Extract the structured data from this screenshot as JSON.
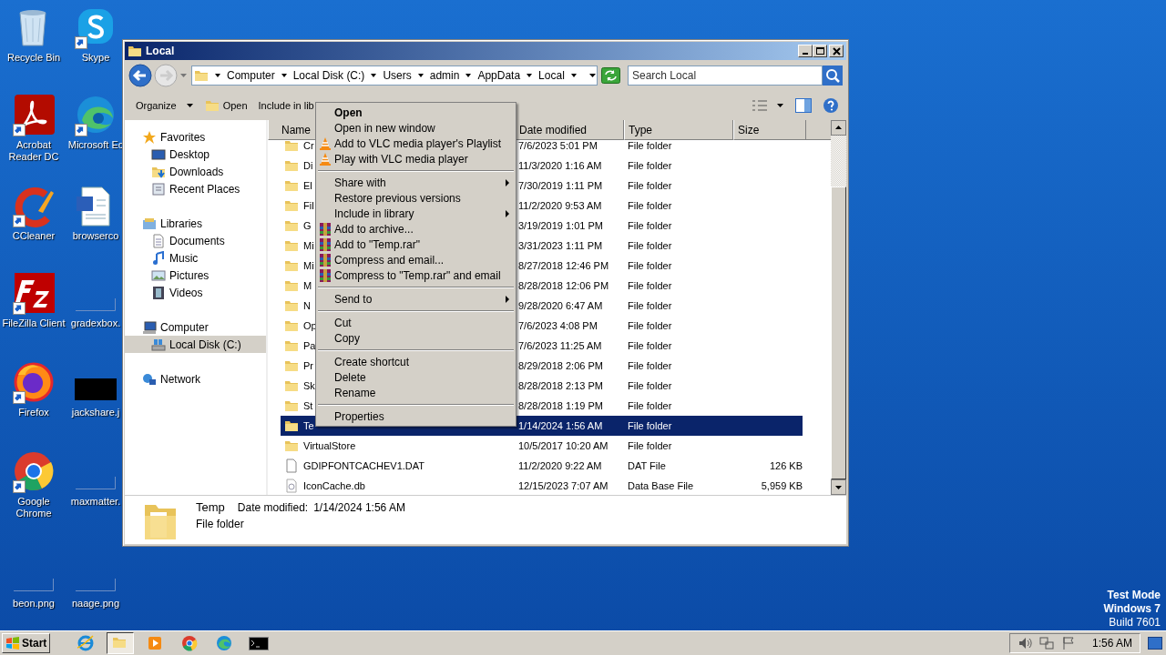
{
  "desktop": {
    "icons": [
      {
        "label": "Recycle Bin",
        "kind": "recycle",
        "shortcut": false
      },
      {
        "label": "Skype",
        "kind": "skype",
        "shortcut": true
      },
      {
        "label": "Acrobat Reader DC",
        "kind": "acrobat",
        "shortcut": true
      },
      {
        "label": "Microsoft Ec",
        "kind": "edge",
        "shortcut": true
      },
      {
        "label": "CCleaner",
        "kind": "ccleaner",
        "shortcut": true
      },
      {
        "label": "browserco",
        "kind": "word",
        "shortcut": false
      },
      {
        "label": "FileZilla Client",
        "kind": "filezilla",
        "shortcut": true
      },
      {
        "label": "gradexbox.",
        "kind": "blank",
        "shortcut": false
      },
      {
        "label": "Firefox",
        "kind": "firefox",
        "shortcut": true
      },
      {
        "label": "jackshare.j",
        "kind": "dark",
        "shortcut": false
      },
      {
        "label": "Google Chrome",
        "kind": "chrome",
        "shortcut": true
      },
      {
        "label": "maxmatter.",
        "kind": "blank",
        "shortcut": false
      },
      {
        "label": "beon.png",
        "kind": "blank",
        "shortcut": false
      },
      {
        "label": "naage.png",
        "kind": "blank",
        "shortcut": false
      }
    ]
  },
  "window": {
    "title": "Local",
    "address": {
      "crumbs": [
        "Computer",
        "Local Disk (C:)",
        "Users",
        "admin",
        "AppData",
        "Local"
      ]
    },
    "search": {
      "placeholder": "Search Local"
    },
    "toolbar": [
      {
        "label": "Organize",
        "kind": "menu"
      },
      {
        "label": "Open",
        "kind": "open"
      },
      {
        "label": "Include in lib",
        "kind": "plain"
      }
    ],
    "nav": [
      {
        "label": "Favorites",
        "selected": false,
        "children": [
          {
            "label": "Desktop",
            "selected": false
          },
          {
            "label": "Downloads",
            "selected": false
          },
          {
            "label": "Recent Places",
            "selected": false
          }
        ]
      },
      {
        "label": "Libraries",
        "selected": false,
        "children": [
          {
            "label": "Documents",
            "selected": false
          },
          {
            "label": "Music",
            "selected": false
          },
          {
            "label": "Pictures",
            "selected": false
          },
          {
            "label": "Videos",
            "selected": false
          }
        ]
      },
      {
        "label": "Computer",
        "selected": false,
        "children": [
          {
            "label": "Local Disk (C:)",
            "selected": true
          }
        ]
      },
      {
        "label": "Network",
        "selected": false
      }
    ],
    "columns": [
      "Name",
      "Date modified",
      "Type",
      "Size"
    ],
    "rows": [
      {
        "name": "Cr",
        "date": "7/6/2023 5:01 PM",
        "type": "File folder",
        "kind": "folder",
        "selected": false
      },
      {
        "name": "Di",
        "date": "11/3/2020 1:16 AM",
        "type": "File folder",
        "kind": "folder",
        "selected": false
      },
      {
        "name": "El",
        "date": "7/30/2019 1:11 PM",
        "type": "File folder",
        "kind": "folder",
        "selected": false
      },
      {
        "name": "Fil",
        "date": "11/2/2020 9:53 AM",
        "type": "File folder",
        "kind": "folder",
        "selected": false
      },
      {
        "name": "G",
        "date": "3/19/2019 1:01 PM",
        "type": "File folder",
        "kind": "folder",
        "selected": false
      },
      {
        "name": "Mi",
        "date": "3/31/2023 1:11 PM",
        "type": "File folder",
        "kind": "folder",
        "selected": false
      },
      {
        "name": "Mi",
        "date": "8/27/2018 12:46 PM",
        "type": "File folder",
        "kind": "folder",
        "selected": false
      },
      {
        "name": "M",
        "date": "8/28/2018 12:06 PM",
        "type": "File folder",
        "kind": "folder",
        "selected": false
      },
      {
        "name": "N",
        "date": "9/28/2020 6:47 AM",
        "type": "File folder",
        "kind": "folder",
        "selected": false
      },
      {
        "name": "Op",
        "date": "7/6/2023 4:08 PM",
        "type": "File folder",
        "kind": "folder",
        "selected": false
      },
      {
        "name": "Pa",
        "date": "7/6/2023 11:25 AM",
        "type": "File folder",
        "kind": "folder",
        "selected": false
      },
      {
        "name": "Pr",
        "date": "8/29/2018 2:06 PM",
        "type": "File folder",
        "kind": "folder",
        "selected": false
      },
      {
        "name": "Sk",
        "date": "8/28/2018 2:13 PM",
        "type": "File folder",
        "kind": "folder",
        "selected": false
      },
      {
        "name": "St",
        "date": "8/28/2018 1:19 PM",
        "type": "File folder",
        "kind": "folder",
        "selected": false
      },
      {
        "name": "Te",
        "date": "1/14/2024 1:56 AM",
        "type": "File folder",
        "kind": "folder",
        "selected": true
      },
      {
        "name": "VirtualStore",
        "date": "10/5/2017 10:20 AM",
        "type": "File folder",
        "kind": "folder",
        "selected": false
      },
      {
        "name": "GDIPFONTCACHEV1.DAT",
        "date": "11/2/2020 9:22 AM",
        "type": "DAT File",
        "size": "126 KB",
        "kind": "file",
        "selected": false
      },
      {
        "name": "IconCache.db",
        "date": "12/15/2023 7:07 AM",
        "type": "Data Base File",
        "size": "5,959 KB",
        "kind": "db",
        "selected": false
      }
    ],
    "details": {
      "name": "Temp",
      "label": "Date modified:",
      "value": "1/14/2024 1:56 AM",
      "type": "File folder"
    }
  },
  "context_menu": {
    "sections": [
      [
        {
          "label": "Open",
          "kind": "text",
          "default": true,
          "submenu": false
        },
        {
          "label": "Open in new window",
          "kind": "text",
          "default": false,
          "submenu": false
        },
        {
          "label": "Add to VLC media player's Playlist",
          "kind": "vlc",
          "default": false,
          "submenu": false
        },
        {
          "label": "Play with VLC media player",
          "kind": "vlc",
          "default": false,
          "submenu": false
        }
      ],
      [
        {
          "label": "Share with",
          "kind": "text",
          "default": false,
          "submenu": true
        },
        {
          "label": "Restore previous versions",
          "kind": "text",
          "default": false,
          "submenu": false
        },
        {
          "label": "Include in library",
          "kind": "text",
          "default": false,
          "submenu": true
        },
        {
          "label": "Add to archive...",
          "kind": "rar",
          "default": false,
          "submenu": false
        },
        {
          "label": "Add to \"Temp.rar\"",
          "kind": "rar",
          "default": false,
          "submenu": false
        },
        {
          "label": "Compress and email...",
          "kind": "rar",
          "default": false,
          "submenu": false
        },
        {
          "label": "Compress to \"Temp.rar\" and email",
          "kind": "rar",
          "default": false,
          "submenu": false
        }
      ],
      [
        {
          "label": "Send to",
          "kind": "text",
          "default": false,
          "submenu": true
        }
      ],
      [
        {
          "label": "Cut",
          "kind": "text",
          "default": false,
          "submenu": false
        },
        {
          "label": "Copy",
          "kind": "text",
          "default": false,
          "submenu": false
        }
      ],
      [
        {
          "label": "Create shortcut",
          "kind": "text",
          "default": false,
          "submenu": false
        },
        {
          "label": "Delete",
          "kind": "text",
          "default": false,
          "submenu": false
        },
        {
          "label": "Rename",
          "kind": "text",
          "default": false,
          "submenu": false
        }
      ],
      [
        {
          "label": "Properties",
          "kind": "text",
          "default": false,
          "submenu": false
        }
      ]
    ]
  },
  "taskbar": {
    "start": "Start",
    "apps": [
      {
        "kind": "ie",
        "active": false
      },
      {
        "kind": "explorer",
        "active": true
      },
      {
        "kind": "media",
        "active": false
      },
      {
        "kind": "chrome",
        "active": false
      },
      {
        "kind": "edge",
        "active": false
      },
      {
        "kind": "cmd",
        "active": false
      }
    ],
    "clock": "1:56 AM"
  },
  "os_notice": [
    {
      "text": "Test Mode",
      "bold": true
    },
    {
      "text": "Windows 7",
      "bold": true
    },
    {
      "text": "Build 7601",
      "bold": false
    }
  ]
}
